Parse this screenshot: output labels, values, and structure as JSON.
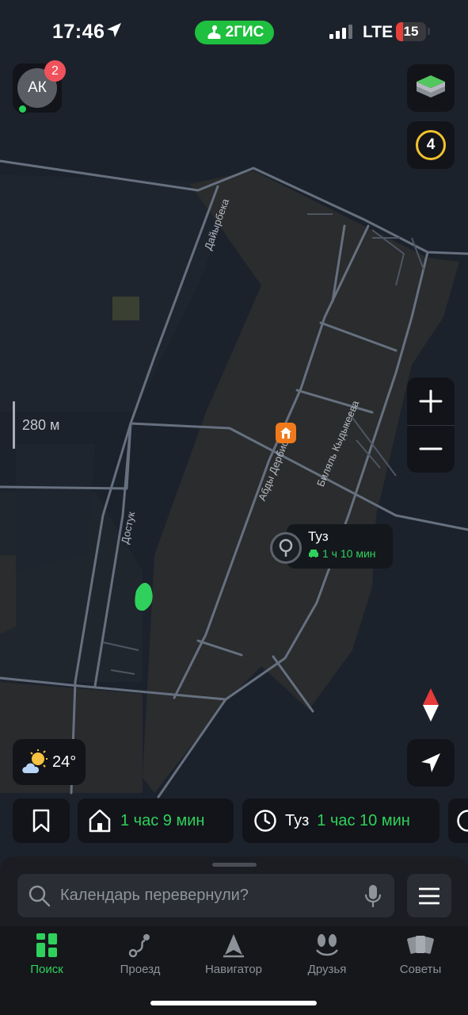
{
  "status_bar": {
    "time": "17:46",
    "brand": "2ГИС",
    "network": "LTE",
    "battery": "15"
  },
  "profile": {
    "initials": "АК",
    "notifications": "2"
  },
  "traffic": {
    "level": "4"
  },
  "scale": {
    "label": "280 м"
  },
  "streets": [
    "Дайырбека",
    "Абды Дербисова",
    "Биляль Кыдыкеева",
    "Достук"
  ],
  "place": {
    "name": "Туз",
    "eta": "1 ч 10 мин"
  },
  "weather": {
    "temperature": "24°"
  },
  "shortcuts": {
    "home_eta": "1 час 9 мин",
    "route_name": "Туз",
    "route_eta": "1 час 10 мин"
  },
  "search": {
    "placeholder": "Календарь перевернули?"
  },
  "tabs": [
    {
      "label": "Поиск",
      "icon": "grid-icon",
      "active": true
    },
    {
      "label": "Проезд",
      "icon": "route-icon"
    },
    {
      "label": "Навигатор",
      "icon": "navigator-icon"
    },
    {
      "label": "Друзья",
      "icon": "friends-icon"
    },
    {
      "label": "Советы",
      "icon": "cards-icon"
    }
  ],
  "colors": {
    "accent": "#2fd15c",
    "brand": "#1fbf3f",
    "traffic": "#f2c12e",
    "poi": "#f07a1b",
    "badge": "#f0525b"
  }
}
